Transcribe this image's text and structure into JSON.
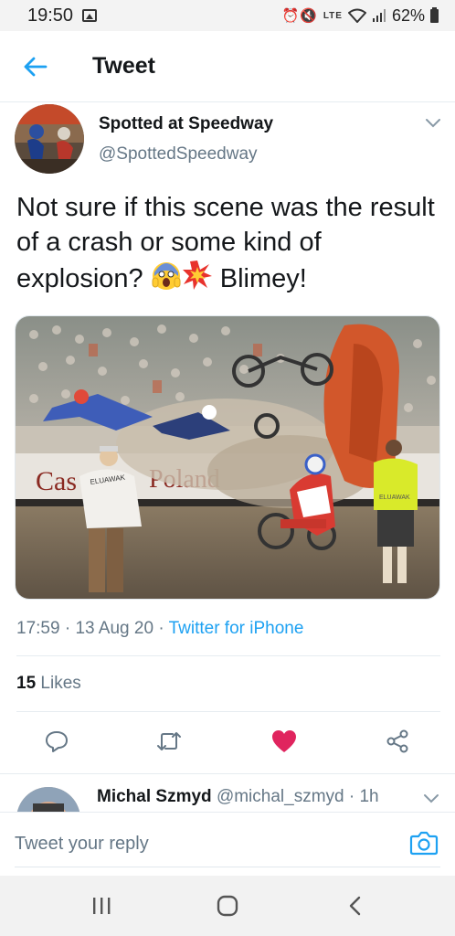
{
  "status_bar": {
    "time": "19:50",
    "battery": "62%",
    "network": "LTE"
  },
  "header": {
    "title": "Tweet"
  },
  "tweet": {
    "display_name": "Spotted at Speedway",
    "handle": "@SpottedSpeedway",
    "text_part1": "Not sure if this scene was the result of a crash or some kind of explosion? ",
    "text_part2": " Blimey!",
    "emojis": [
      "screaming-face-emoji",
      "collision-emoji"
    ],
    "image_texts": {
      "banner": "Casino Poland",
      "shirt": "ELUAWAK",
      "vest": "ELUAWAK"
    },
    "time": "17:59",
    "date": "13 Aug 20",
    "separator": "·",
    "source": "Twitter for iPhone",
    "likes_count": "15",
    "likes_label": "Likes",
    "liked": true
  },
  "reply_preview": {
    "name": "Michal Szmyd",
    "handle": "@michal_szmyd",
    "time": "· 1h"
  },
  "compose": {
    "placeholder": "Tweet your reply"
  },
  "colors": {
    "accent": "#1da1f2",
    "like": "#e0245e",
    "secondary_text": "#657786"
  },
  "icons": [
    "back-arrow-icon",
    "chevron-down-icon",
    "reply-icon",
    "retweet-icon",
    "heart-icon",
    "share-icon",
    "camera-icon",
    "recents-icon",
    "home-icon",
    "back-icon"
  ]
}
